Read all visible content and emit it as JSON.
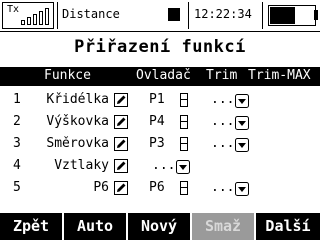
{
  "status": {
    "tx_label": "Tx",
    "model_name": "Distance",
    "clock": "12:22:34",
    "battery_text": "57%",
    "signal_bars": 5,
    "battery_level_percent": 57
  },
  "title": "Přiřazení funkcí",
  "table": {
    "headers": {
      "funkce": "Funkce",
      "ovladac": "Ovladač",
      "trim": "Trim",
      "trim_max": "Trim-MAX"
    },
    "rows": [
      {
        "num": "1",
        "name": "Křidélka",
        "control": "P1",
        "trim": "..."
      },
      {
        "num": "2",
        "name": "Výškovka",
        "control": "P4",
        "trim": "..."
      },
      {
        "num": "3",
        "name": "Směrovka",
        "control": "P3",
        "trim": "..."
      },
      {
        "num": "4",
        "name": "Vztlaky",
        "control": "...",
        "trim": ""
      },
      {
        "num": "5",
        "name": "P6",
        "control": "P6",
        "trim": "..."
      }
    ]
  },
  "buttons": {
    "back": "Zpět",
    "auto": "Auto",
    "new": "Nový",
    "delete": "Smaž",
    "next": "Další"
  },
  "icons": {
    "edit": "pencil-icon",
    "dropdown": "down-arrow-icon",
    "switch": "switch-icon"
  }
}
